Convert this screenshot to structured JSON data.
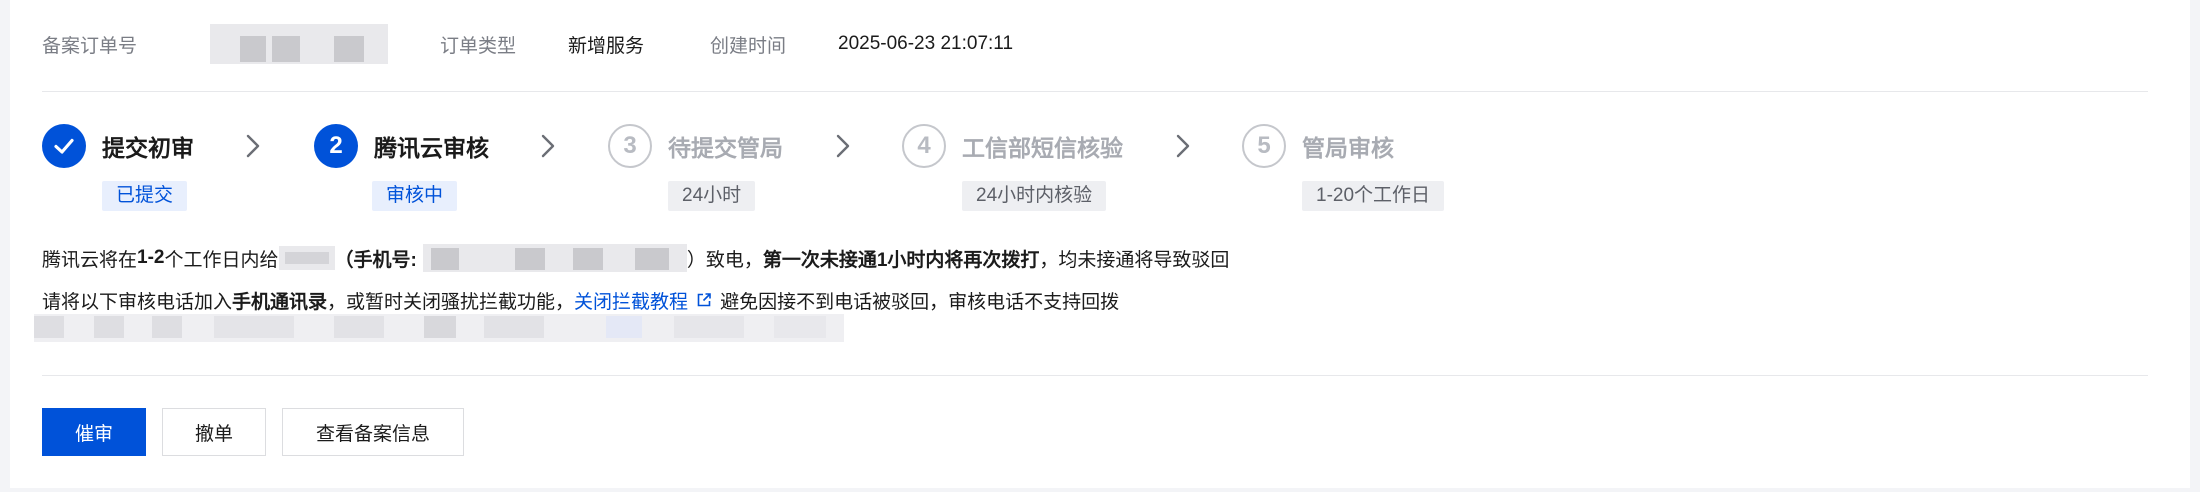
{
  "order": {
    "number_label": "备案订单号",
    "type_label": "订单类型",
    "type_value": "新增服务",
    "created_label": "创建时间",
    "created_value": "2025-06-23 21:07:11"
  },
  "steps": [
    {
      "index": "✓",
      "title": "提交初审",
      "status": "已提交",
      "state": "done"
    },
    {
      "index": "2",
      "title": "腾讯云审核",
      "status": "审核中",
      "state": "active"
    },
    {
      "index": "3",
      "title": "待提交管局",
      "status": "24小时",
      "state": "todo"
    },
    {
      "index": "4",
      "title": "工信部短信核验",
      "status": "24小时内核验",
      "state": "todo"
    },
    {
      "index": "5",
      "title": "管局审核",
      "status": "1-20个工作日",
      "state": "todo"
    }
  ],
  "notice": {
    "l1_a": "腾讯云将在 ",
    "l1_b": "1-2",
    "l1_c": " 个工作日内给",
    "l1_d": "（手机号:",
    "l1_e": "）致电，",
    "l1_f": "第一次未接通1小时内将再次拨打",
    "l1_g": "，均未接通将导致驳回",
    "l2_a": "请将以下审核电话加入",
    "l2_b": "手机通讯录",
    "l2_c": "，或暂时关闭骚扰拦截功能，",
    "l2_link": "关闭拦截教程",
    "l2_d": "避免因接不到电话被驳回，审核电话不支持回拨"
  },
  "actions": {
    "urge": "催审",
    "withdraw": "撤单",
    "view": "查看备案信息"
  },
  "colors": {
    "primary": "#0052d9",
    "tag_blue_bg": "#e8effd",
    "tag_grey_bg": "#eeeff2"
  },
  "icons": {
    "done": "check-icon",
    "separator": "chevron-right-icon",
    "external": "external-link-icon"
  }
}
